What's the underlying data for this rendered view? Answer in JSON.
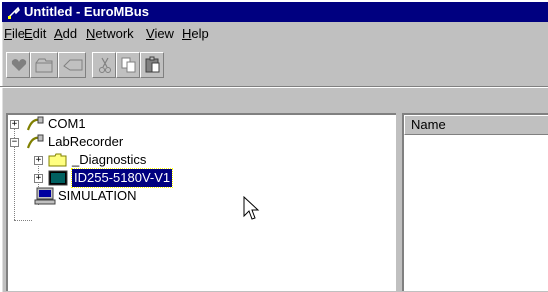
{
  "window": {
    "title": "Untitled - EuroMBus"
  },
  "menu": [
    {
      "label": "File",
      "underline": "F",
      "rest": "ile"
    },
    {
      "label": "Edit",
      "underline": "E",
      "rest": "dit"
    },
    {
      "label": "Add",
      "underline": "A",
      "rest": "dd"
    },
    {
      "label": "Network",
      "underline": "N",
      "rest": "etwork"
    },
    {
      "label": "View",
      "underline": "V",
      "rest": "iew"
    },
    {
      "label": "Help",
      "underline": "H",
      "rest": "elp"
    }
  ],
  "toolbar": {
    "buttons": [
      "heart-icon",
      "open-icon",
      "eraser-icon",
      "cut-icon",
      "copy-icon",
      "paste-icon"
    ]
  },
  "tree": {
    "items": [
      {
        "label": "COM1",
        "icon": "port-icon",
        "expander": "+"
      },
      {
        "label": "LabRecorder",
        "icon": "port-icon",
        "expander": "−"
      },
      {
        "label": "_Diagnostics",
        "icon": "folder-icon",
        "expander": "+"
      },
      {
        "label": "ID255-5180V-V1",
        "icon": "device-icon",
        "expander": "+"
      },
      {
        "label": "SIMULATION",
        "icon": "computer-icon",
        "expander": ""
      }
    ]
  },
  "list": {
    "column_name": "Name"
  },
  "colors": {
    "titlebar": "#000080",
    "selection": "#000080",
    "face": "#c0c0c0"
  }
}
